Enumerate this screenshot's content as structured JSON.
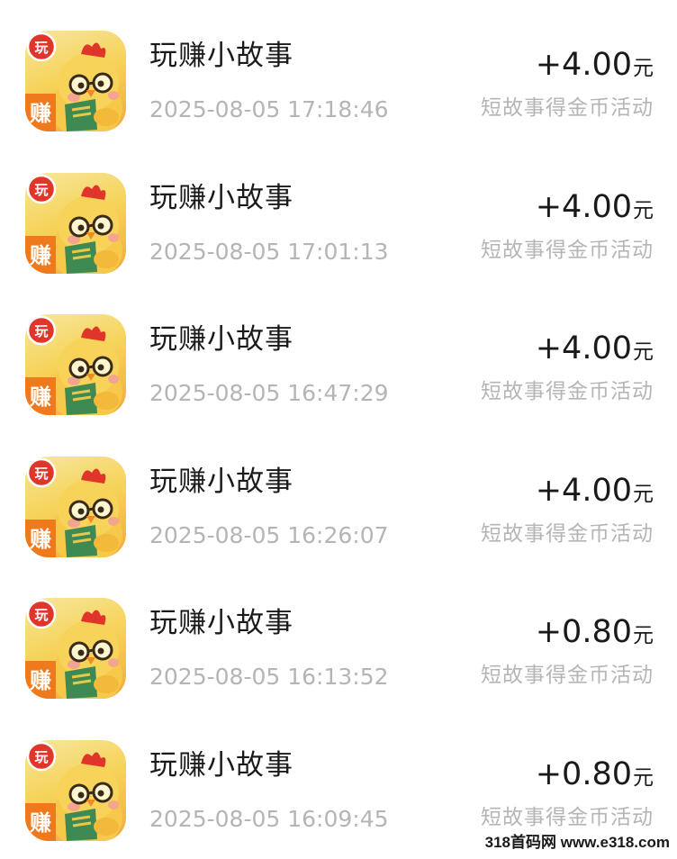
{
  "transactions": [
    {
      "app_name": "玩赚小故事",
      "timestamp": "2025-08-05 17:18:46",
      "amount": "+4.00",
      "unit": "元",
      "description": "短故事得金币活动",
      "icon": "chick-app-icon",
      "badge_top": "玩",
      "badge_bottom": "赚"
    },
    {
      "app_name": "玩赚小故事",
      "timestamp": "2025-08-05 17:01:13",
      "amount": "+4.00",
      "unit": "元",
      "description": "短故事得金币活动",
      "icon": "chick-app-icon",
      "badge_top": "玩",
      "badge_bottom": "赚"
    },
    {
      "app_name": "玩赚小故事",
      "timestamp": "2025-08-05 16:47:29",
      "amount": "+4.00",
      "unit": "元",
      "description": "短故事得金币活动",
      "icon": "chick-app-icon",
      "badge_top": "玩",
      "badge_bottom": "赚"
    },
    {
      "app_name": "玩赚小故事",
      "timestamp": "2025-08-05 16:26:07",
      "amount": "+4.00",
      "unit": "元",
      "description": "短故事得金币活动",
      "icon": "chick-app-icon",
      "badge_top": "玩",
      "badge_bottom": "赚"
    },
    {
      "app_name": "玩赚小故事",
      "timestamp": "2025-08-05 16:13:52",
      "amount": "+0.80",
      "unit": "元",
      "description": "短故事得金币活动",
      "icon": "chick-app-icon",
      "badge_top": "玩",
      "badge_bottom": "赚"
    },
    {
      "app_name": "玩赚小故事",
      "timestamp": "2025-08-05 16:09:45",
      "amount": "+0.80",
      "unit": "元",
      "description": "短故事得金币活动",
      "icon": "chick-app-icon",
      "badge_top": "玩",
      "badge_bottom": "赚"
    }
  ],
  "watermark": "318首码网 www.e318.com",
  "colors": {
    "title_text": "#1a1a1a",
    "secondary_text": "#b5b5b5",
    "badge_red": "#e0352b",
    "badge_orange": "#ef7a1e"
  }
}
